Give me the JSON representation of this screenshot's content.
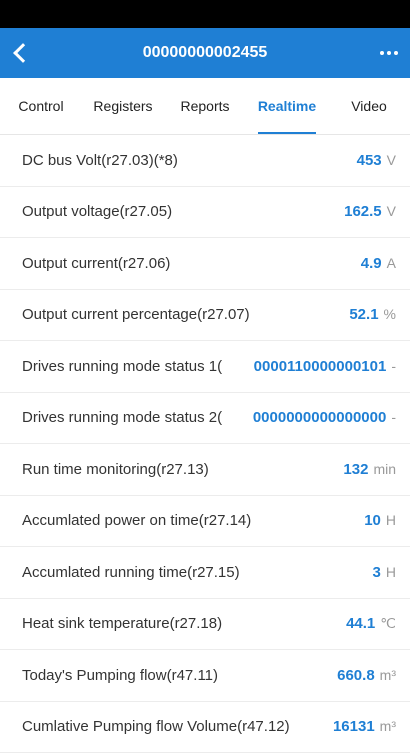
{
  "header": {
    "title": "00000000002455"
  },
  "tabs": [
    {
      "label": "Control"
    },
    {
      "label": "Registers"
    },
    {
      "label": "Reports"
    },
    {
      "label": "Realtime"
    },
    {
      "label": "Video"
    }
  ],
  "active_tab": "Realtime",
  "rows": [
    {
      "label": "DC bus Volt(r27.03)(*8)",
      "value": "453",
      "unit": "V"
    },
    {
      "label": "Output voltage(r27.05)",
      "value": "162.5",
      "unit": "V"
    },
    {
      "label": "Output current(r27.06)",
      "value": "4.9",
      "unit": "A"
    },
    {
      "label": "Output current percentage(r27.07)",
      "value": "52.1",
      "unit": "%"
    },
    {
      "label": "Drives running mode status 1(",
      "value": "0000110000000101",
      "unit": "-"
    },
    {
      "label": "Drives running mode status 2(",
      "value": "0000000000000000",
      "unit": "-"
    },
    {
      "label": "Run time monitoring(r27.13)",
      "value": "132",
      "unit": "min"
    },
    {
      "label": "Accumlated power on time(r27.14)",
      "value": "10",
      "unit": "H"
    },
    {
      "label": "Accumlated running time(r27.15)",
      "value": "3",
      "unit": "H"
    },
    {
      "label": "Heat sink temperature(r27.18)",
      "value": "44.1",
      "unit": "℃"
    },
    {
      "label": "Today's Pumping flow(r47.11)",
      "value": "660.8",
      "unit": "m³"
    },
    {
      "label": "Cumlative Pumping flow Volume(r47.12)",
      "value": "16131",
      "unit": "m³"
    }
  ]
}
